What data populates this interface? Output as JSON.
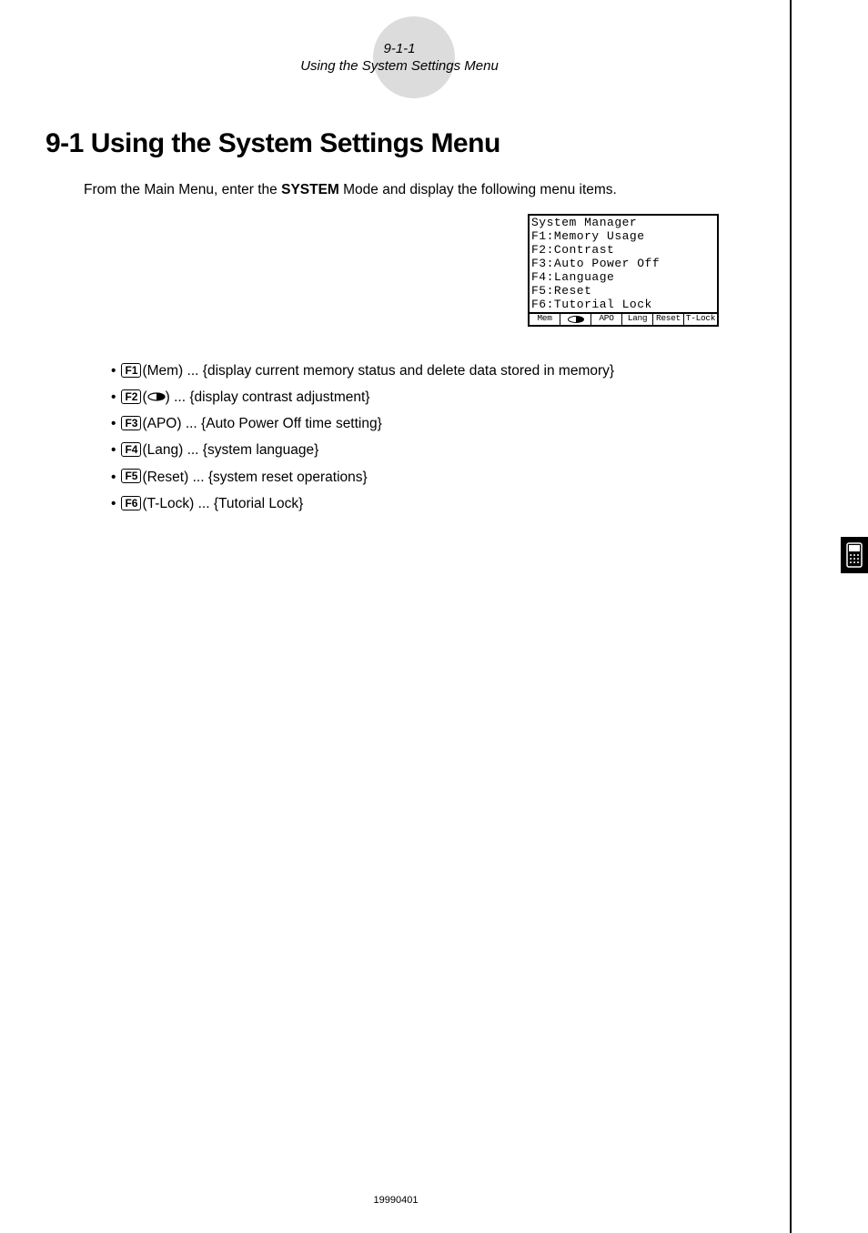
{
  "header": {
    "page_number": "9-1-1",
    "page_subtitle": "Using the System Settings Menu"
  },
  "section_title": "9-1 Using the System Settings Menu",
  "intro_prefix": "From the Main Menu, enter the ",
  "intro_bold": "SYSTEM",
  "intro_suffix": " Mode and display the following menu items.",
  "screenshot": {
    "title": "System Manager",
    "rows": [
      "F1:Memory Usage",
      "F2:Contrast",
      "F3:Auto Power Off",
      "F4:Language",
      "F5:Reset",
      "F6:Tutorial Lock"
    ],
    "footer": [
      "Mem",
      "",
      "APO",
      "Lang",
      "Reset",
      "T-Lock"
    ]
  },
  "bullets": [
    {
      "key": "F1",
      "label": "(Mem)",
      "desc": " ... {display current memory status and delete data stored in memory}"
    },
    {
      "key": "F2",
      "label": "(",
      "desc": ") ... {display contrast adjustment}",
      "has_icon": true
    },
    {
      "key": "F3",
      "label": "(APO)",
      "desc": " ... {Auto Power Off time setting}"
    },
    {
      "key": "F4",
      "label": "(Lang)",
      "desc": " ... {system language}"
    },
    {
      "key": "F5",
      "label": "(Reset)",
      "desc": " ... {system reset operations}"
    },
    {
      "key": "F6",
      "label": "(T-Lock)",
      "desc": " ... {Tutorial Lock}"
    }
  ],
  "footer_code": "19990401"
}
